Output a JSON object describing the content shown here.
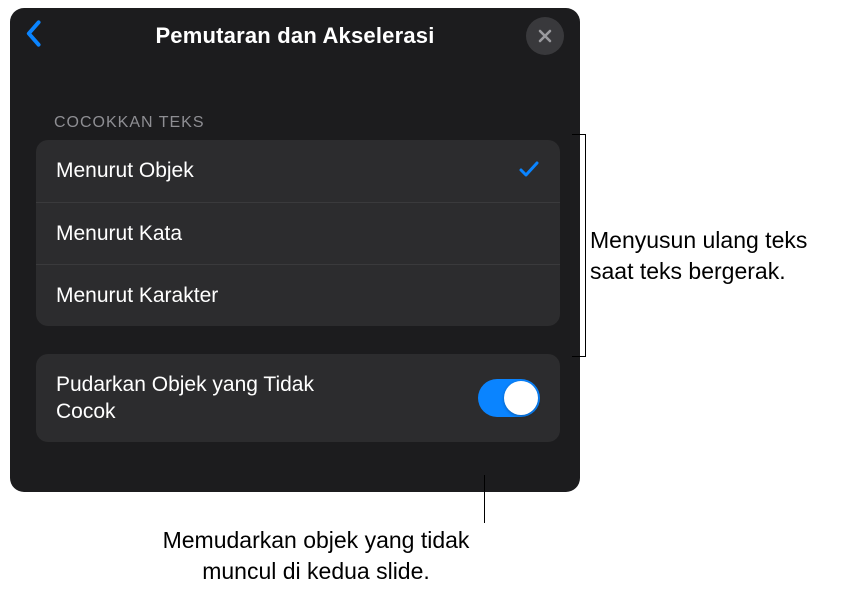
{
  "header": {
    "title": "Pemutaran dan Akselerasi"
  },
  "section": {
    "header": "COCOKKAN TEKS",
    "options": [
      {
        "label": "Menurut Objek",
        "selected": true
      },
      {
        "label": "Menurut Kata",
        "selected": false
      },
      {
        "label": "Menurut Karakter",
        "selected": false
      }
    ]
  },
  "toggle": {
    "label": "Pudarkan Objek yang Tidak Cocok",
    "on": true
  },
  "callouts": {
    "right": "Menyusun ulang teks saat teks bergerak.",
    "bottom": "Memudarkan objek yang tidak muncul di kedua slide."
  }
}
